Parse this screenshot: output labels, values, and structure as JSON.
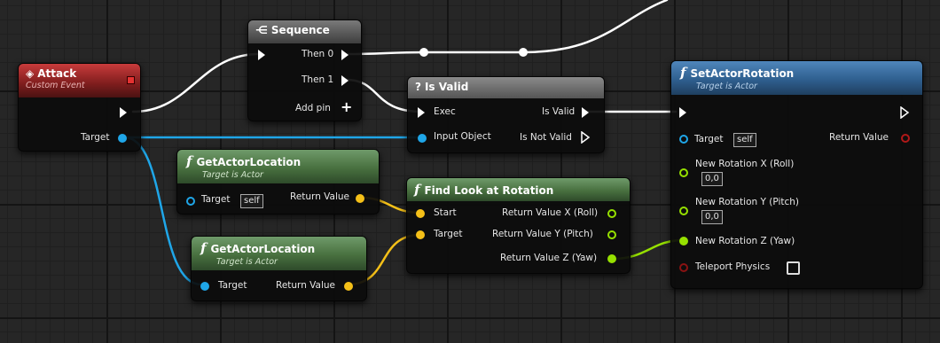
{
  "colors": {
    "exec": "#ffffff",
    "object": "#1fa6e8",
    "vector": "#f5c018",
    "float": "#96e000",
    "bool": "#8a1212",
    "event_header": "#b52f2f",
    "function_header": "#3e73a6",
    "pure_header": "#5b8a52"
  },
  "attack": {
    "icon": "event-diamond-icon",
    "title": "Attack",
    "subtitle": "Custom Event",
    "target": "Target"
  },
  "sequence": {
    "icon": "sequence-icon",
    "title": "Sequence",
    "then0": "Then 0",
    "then1": "Then 1",
    "add_pin": "Add pin",
    "add_icon": "+"
  },
  "is_valid": {
    "icon": "?",
    "title": "Is Valid",
    "exec": "Exec",
    "is_valid": "Is Valid",
    "input_object": "Input Object",
    "is_not_valid": "Is Not Valid"
  },
  "get_loc1": {
    "fx": "f",
    "title": "GetActorLocation",
    "subtitle": "Target is Actor",
    "target": "Target",
    "self": "self",
    "return": "Return Value"
  },
  "get_loc2": {
    "fx": "f",
    "title": "GetActorLocation",
    "subtitle": "Target is Actor",
    "target": "Target",
    "return": "Return Value"
  },
  "find_look": {
    "fx": "f",
    "title": "Find Look at Rotation",
    "start": "Start",
    "target": "Target",
    "rx": "Return Value X (Roll)",
    "ry": "Return Value Y (Pitch)",
    "rz": "Return Value Z (Yaw)"
  },
  "set_rot": {
    "fx": "f",
    "title": "SetActorRotation",
    "subtitle": "Target is Actor",
    "target": "Target",
    "self": "self",
    "return": "Return Value",
    "rot_x": "New Rotation X (Roll)",
    "rot_x_val": "0,0",
    "rot_y": "New Rotation Y (Pitch)",
    "rot_y_val": "0,0",
    "rot_z": "New Rotation Z (Yaw)",
    "teleport": "Teleport Physics"
  }
}
